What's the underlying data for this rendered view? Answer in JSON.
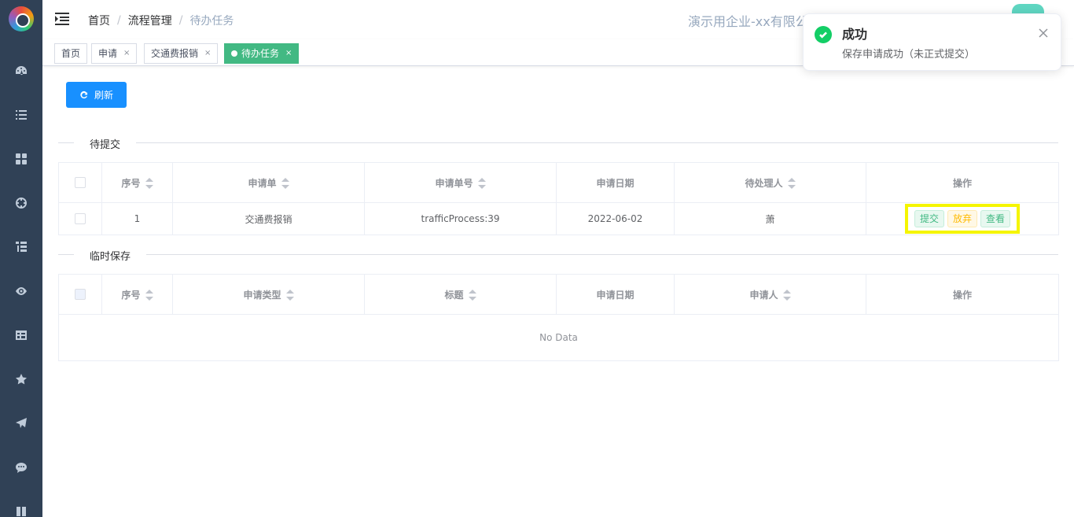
{
  "header": {
    "breadcrumb": [
      "首页",
      "流程管理",
      "待办任务"
    ],
    "company": "演示用企业-xx有限公"
  },
  "tags": [
    {
      "label": "首页",
      "closable": false,
      "active": false
    },
    {
      "label": "申请",
      "closable": true,
      "active": false
    },
    {
      "label": "交通费报销",
      "closable": true,
      "active": false
    },
    {
      "label": "待办任务",
      "closable": true,
      "active": true
    }
  ],
  "close_glyph": "×",
  "sidebar": {
    "icons": [
      "dashboard-icon",
      "list-icon",
      "grid-icon",
      "target-icon",
      "tree-icon",
      "eye-icon",
      "table-icon",
      "star-icon",
      "send-icon",
      "chat-icon",
      "book-icon"
    ]
  },
  "toolbar": {
    "refresh_label": "刷新"
  },
  "pending": {
    "section_title": "待提交",
    "headers": [
      "序号",
      "申请单",
      "申请单号",
      "申请日期",
      "待处理人",
      "操作"
    ],
    "rows": [
      {
        "index": "1",
        "form": "交通费报销",
        "form_no": "trafficProcess:39",
        "date": "2022-06-02",
        "handler": "萧",
        "actions": {
          "submit": "提交",
          "abandon": "放弃",
          "view": "查看"
        }
      }
    ]
  },
  "drafts": {
    "section_title": "临时保存",
    "headers": [
      "序号",
      "申请类型",
      "标题",
      "申请日期",
      "申请人",
      "操作"
    ],
    "empty_text": "No Data"
  },
  "notification": {
    "title": "成功",
    "message": "保存申请成功（未正式提交）"
  }
}
